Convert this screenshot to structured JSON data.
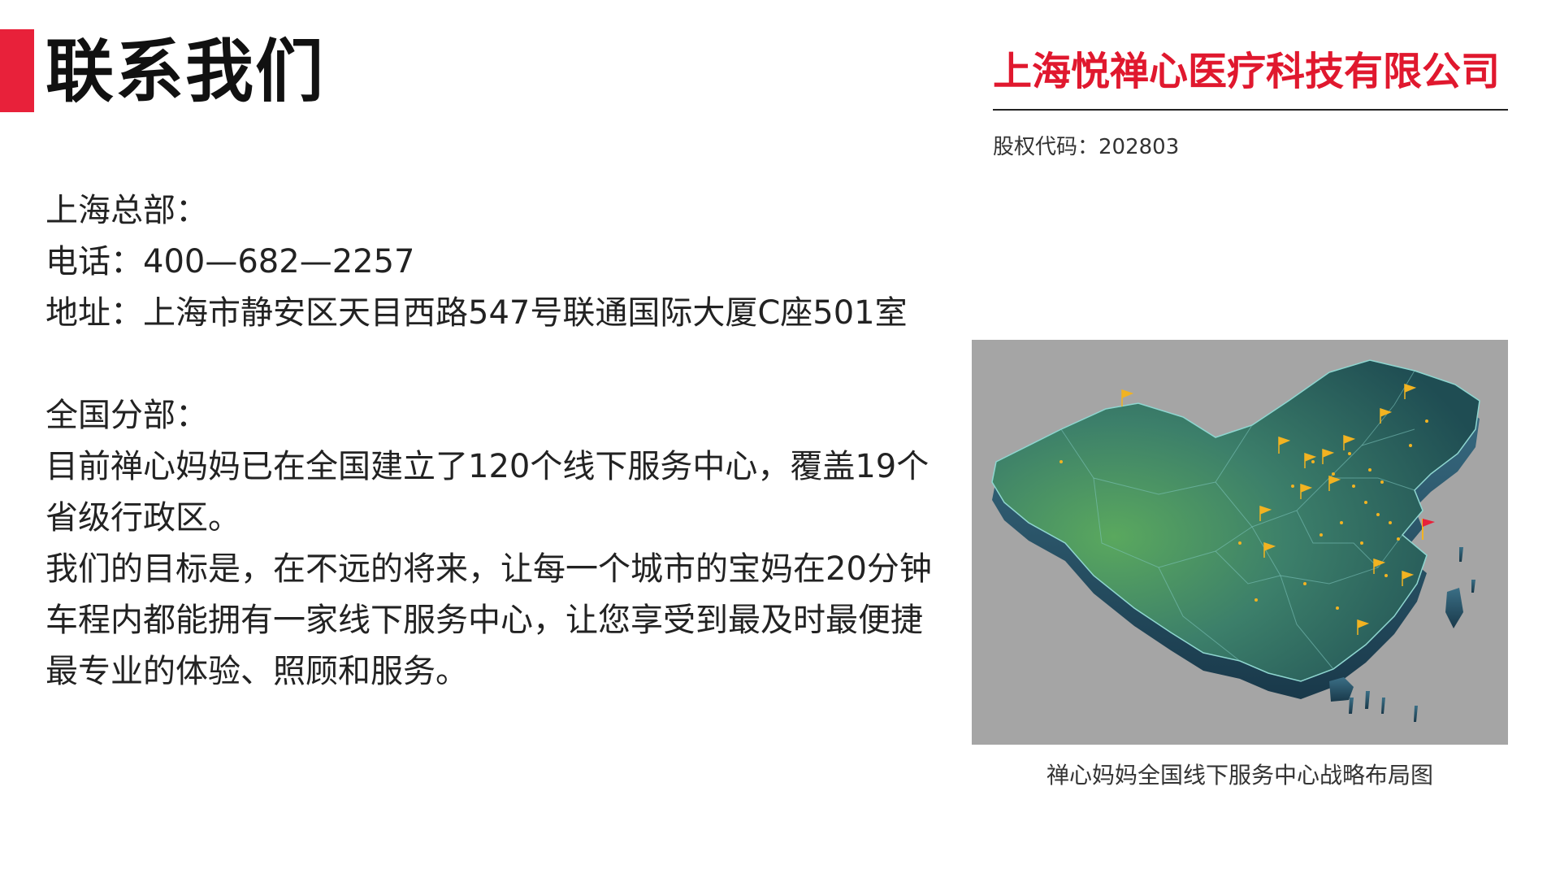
{
  "header": {
    "title": "联系我们",
    "accent_color": "#e8213a"
  },
  "company": {
    "name": "上海悦禅心医疗科技有限公司",
    "name_color": "#e0182e",
    "stock_code": "股权代码：202803"
  },
  "hq": {
    "heading": "上海总部：",
    "phone": "电话：400—682—2257",
    "address": "地址：上海市静安区天目西路547号联通国际大厦C座501室"
  },
  "branches": {
    "heading": "全国分部：",
    "para1": "目前禅心妈妈已在全国建立了120个线下服务中心，覆盖19个省级行政区。",
    "para2": "我们的目标是，在不远的将来，让每一个城市的宝妈在20分钟车程内都能拥有一家线下服务中心，让您享受到最及时最便捷最专业的体验、照顾和服务。"
  },
  "map": {
    "caption": "禅心妈妈全国线下服务中心战略布局图",
    "icons": {
      "pin": "yellow-flag-pin-icon",
      "hq": "red-flag-pin-icon"
    },
    "colors": {
      "background": "#a5a5a5",
      "land_light": "#5aa85e",
      "land_dark": "#1f4d53",
      "pin": "#f2b321",
      "hq_flag": "#e8213a"
    }
  }
}
